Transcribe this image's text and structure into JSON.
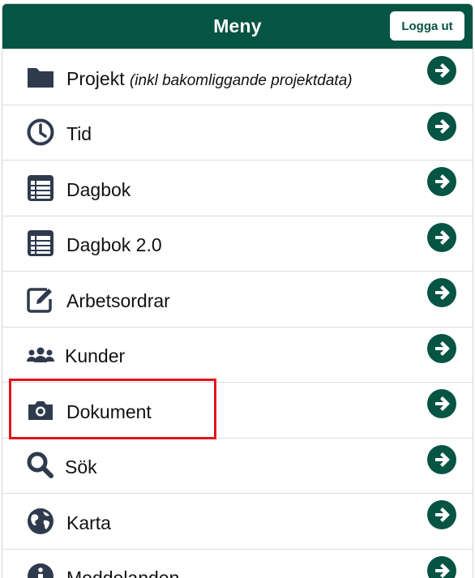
{
  "header": {
    "title": "Meny",
    "logout_label": "Logga ut"
  },
  "colors": {
    "brand": "#065443",
    "icon": "#2f3a4d",
    "highlight": "#e0141e"
  },
  "menu": {
    "items": [
      {
        "label": "Projekt",
        "note": "(inkl bakomliggande projektdata)",
        "icon": "folder-icon"
      },
      {
        "label": "Tid",
        "icon": "clock-icon"
      },
      {
        "label": "Dagbok",
        "icon": "list-table-icon"
      },
      {
        "label": "Dagbok 2.0",
        "icon": "list-table-icon"
      },
      {
        "label": "Arbetsordrar",
        "icon": "edit-icon"
      },
      {
        "label": "Kunder",
        "icon": "users-icon"
      },
      {
        "label": "Dokument",
        "icon": "camera-icon"
      },
      {
        "label": "Sök",
        "icon": "search-icon"
      },
      {
        "label": "Karta",
        "icon": "globe-icon"
      },
      {
        "label": "Meddelanden",
        "icon": "info-icon"
      }
    ]
  }
}
